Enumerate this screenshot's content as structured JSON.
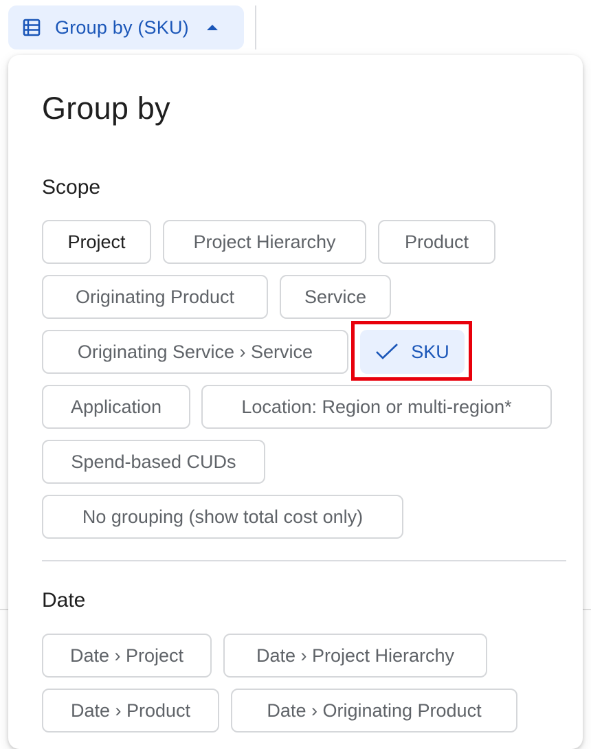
{
  "toolbar": {
    "group_by_button_label": "Group by (SKU)",
    "group_by_icon": "table-rows-icon",
    "caret_icon": "caret-up-icon",
    "accent_color": "#1a56b8",
    "accent_bg": "#e8f0fe"
  },
  "panel": {
    "title": "Group by",
    "sections": [
      {
        "label": "Scope",
        "chips": [
          {
            "label": "Project",
            "selected": false
          },
          {
            "label": "Project Hierarchy",
            "selected": false
          },
          {
            "label": "Product",
            "selected": false
          },
          {
            "label": "Originating Product",
            "selected": false
          },
          {
            "label": "Service",
            "selected": false
          },
          {
            "label": "Originating Service › Service",
            "selected": false
          },
          {
            "label": "SKU",
            "selected": true,
            "icon": "check-icon"
          },
          {
            "label": "Application",
            "selected": false
          },
          {
            "label": "Location: Region or multi-region*",
            "selected": false
          },
          {
            "label": "Spend-based CUDs",
            "selected": false
          },
          {
            "label": "No grouping (show total cost only)",
            "selected": false
          }
        ]
      },
      {
        "label": "Date",
        "chips": [
          {
            "label": "Date › Project",
            "selected": false
          },
          {
            "label": "Date › Project Hierarchy",
            "selected": false
          },
          {
            "label": "Date › Product",
            "selected": false
          },
          {
            "label": "Date › Originating Product",
            "selected": false
          }
        ]
      }
    ]
  },
  "annotation": {
    "highlight_color": "#e8000b",
    "highlighted_chip": "SKU"
  }
}
